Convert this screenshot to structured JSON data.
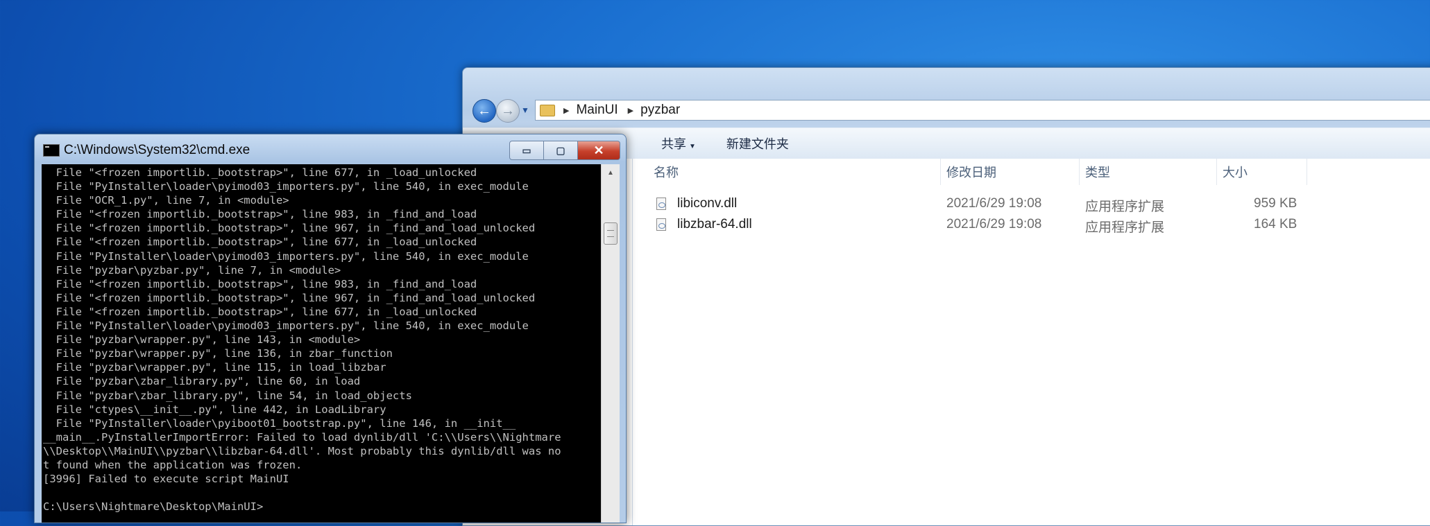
{
  "explorer": {
    "address": {
      "crumbs": [
        "MainUI",
        "pyzbar"
      ]
    },
    "toolbar": {
      "share_label": "共享",
      "new_folder_label": "新建文件夹"
    },
    "columns": {
      "name": "名称",
      "date": "修改日期",
      "type": "类型",
      "size": "大小"
    },
    "files": [
      {
        "name": "libiconv.dll",
        "date": "2021/6/29 19:08",
        "type": "应用程序扩展",
        "size": "959 KB"
      },
      {
        "name": "libzbar-64.dll",
        "date": "2021/6/29 19:08",
        "type": "应用程序扩展",
        "size": "164 KB"
      }
    ]
  },
  "cmd": {
    "title": "C:\\Windows\\System32\\cmd.exe",
    "minimize_glyph": "▭",
    "maximize_glyph": "▢",
    "close_glyph": "✕",
    "output": "  File \"<frozen importlib._bootstrap>\", line 677, in _load_unlocked\n  File \"PyInstaller\\loader\\pyimod03_importers.py\", line 540, in exec_module\n  File \"OCR_1.py\", line 7, in <module>\n  File \"<frozen importlib._bootstrap>\", line 983, in _find_and_load\n  File \"<frozen importlib._bootstrap>\", line 967, in _find_and_load_unlocked\n  File \"<frozen importlib._bootstrap>\", line 677, in _load_unlocked\n  File \"PyInstaller\\loader\\pyimod03_importers.py\", line 540, in exec_module\n  File \"pyzbar\\pyzbar.py\", line 7, in <module>\n  File \"<frozen importlib._bootstrap>\", line 983, in _find_and_load\n  File \"<frozen importlib._bootstrap>\", line 967, in _find_and_load_unlocked\n  File \"<frozen importlib._bootstrap>\", line 677, in _load_unlocked\n  File \"PyInstaller\\loader\\pyimod03_importers.py\", line 540, in exec_module\n  File \"pyzbar\\wrapper.py\", line 143, in <module>\n  File \"pyzbar\\wrapper.py\", line 136, in zbar_function\n  File \"pyzbar\\wrapper.py\", line 115, in load_libzbar\n  File \"pyzbar\\zbar_library.py\", line 60, in load\n  File \"pyzbar\\zbar_library.py\", line 54, in load_objects\n  File \"ctypes\\__init__.py\", line 442, in LoadLibrary\n  File \"PyInstaller\\loader\\pyiboot01_bootstrap.py\", line 146, in __init__\n__main__.PyInstallerImportError: Failed to load dynlib/dll 'C:\\\\Users\\\\Nightmare\n\\\\Desktop\\\\MainUI\\\\pyzbar\\\\libzbar-64.dll'. Most probably this dynlib/dll was no\nt found when the application was frozen.\n[3996] Failed to execute script MainUI\n\nC:\\Users\\Nightmare\\Desktop\\MainUI>"
  }
}
